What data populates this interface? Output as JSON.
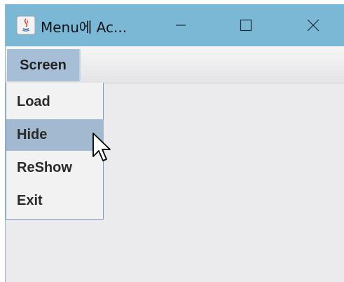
{
  "window": {
    "title": "Menu에 Ac..."
  },
  "titlebar": {
    "icons": {
      "app": "java-icon",
      "minimize": "minimize-icon",
      "maximize": "maximize-icon",
      "close": "close-icon"
    }
  },
  "menubar": {
    "menus": [
      {
        "label": "Screen"
      }
    ]
  },
  "dropdown": {
    "items": [
      {
        "label": "Load"
      },
      {
        "label": "Hide"
      },
      {
        "label": "ReShow"
      },
      {
        "label": "Exit"
      }
    ],
    "highlighted": "Hide"
  },
  "colors": {
    "titlebar": "#7ab8d6",
    "menu_selected": "#a7bfd6",
    "item_highlight": "#a3b9cf",
    "content_bg": "#ebebed"
  }
}
